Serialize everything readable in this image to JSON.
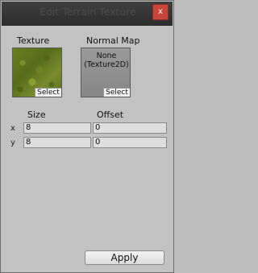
{
  "window": {
    "title": "Edit Terrain Texture",
    "close_label": "x"
  },
  "texture": {
    "label": "Texture",
    "select_label": "Select"
  },
  "normal_map": {
    "label": "Normal Map",
    "value_line1": "None",
    "value_line2": "(Texture2D)",
    "select_label": "Select"
  },
  "tiling": {
    "size_label": "Size",
    "offset_label": "Offset",
    "x_axis": "x",
    "y_axis": "y",
    "size_x": "8",
    "offset_x": "0",
    "size_y": "8",
    "offset_y": "0"
  },
  "apply_label": "Apply"
}
